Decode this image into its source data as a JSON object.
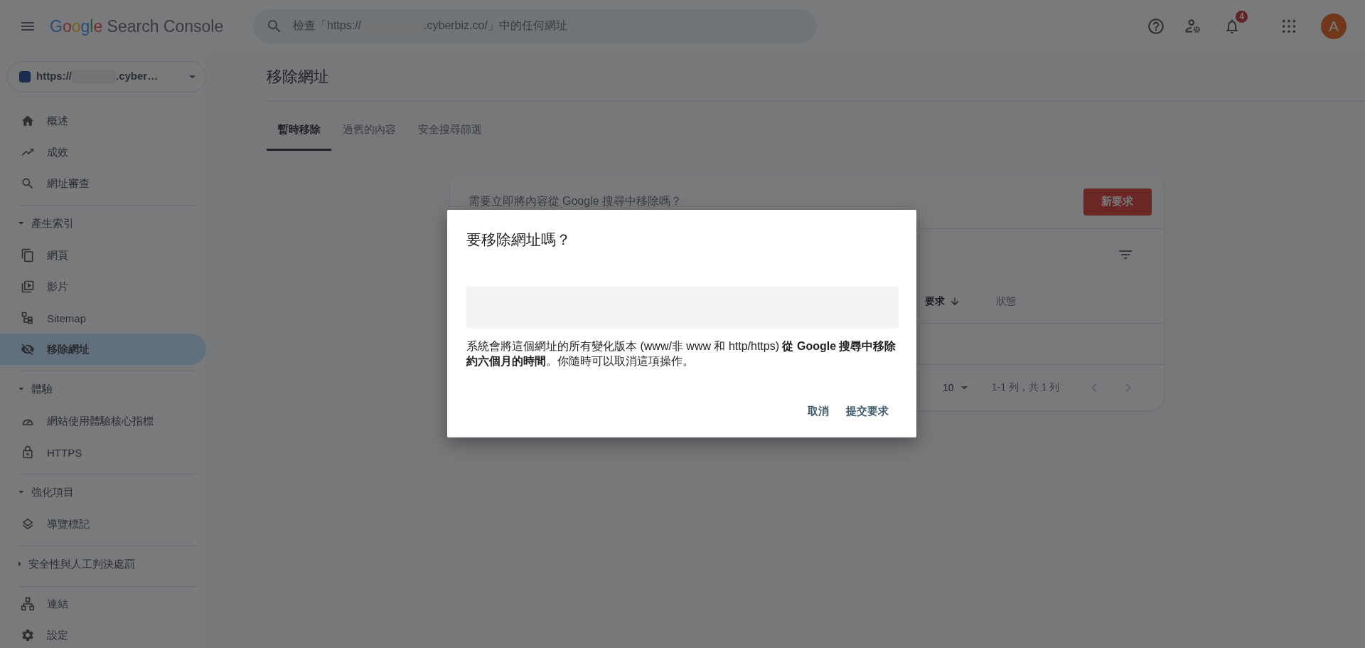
{
  "header": {
    "logo_brand": "Google",
    "logo_product": "Search Console",
    "search": {
      "placeholder_parts": [
        "檢查「https://",
        ".cyberbiz.co/」中的任何網址"
      ]
    },
    "notification_count": "4",
    "avatar_letter": "A"
  },
  "sidebar": {
    "property": {
      "url_parts": [
        "https://",
        ".cyber…"
      ]
    },
    "groups": [
      {
        "items": [
          {
            "label": "概述",
            "selected": false
          },
          {
            "label": "成效",
            "selected": false
          },
          {
            "label": "網址審查",
            "selected": false
          }
        ]
      },
      {
        "title": "產生索引",
        "expanded": true,
        "items": [
          {
            "label": "網頁",
            "selected": false
          },
          {
            "label": "影片",
            "selected": false
          },
          {
            "label": "Sitemap",
            "selected": false
          },
          {
            "label": "移除網址",
            "selected": true
          }
        ]
      },
      {
        "title": "體驗",
        "expanded": true,
        "items": [
          {
            "label": "網站使用體驗核心指標",
            "selected": false
          },
          {
            "label": "HTTPS",
            "selected": false
          }
        ]
      },
      {
        "title": "強化項目",
        "expanded": true,
        "items": [
          {
            "label": "導覽標記",
            "selected": false
          }
        ]
      },
      {
        "title": "安全性與人工判決處罰",
        "expanded": false
      },
      {
        "items": [
          {
            "label": "連結",
            "selected": false
          },
          {
            "label": "設定",
            "selected": false
          }
        ]
      }
    ]
  },
  "page": {
    "title": "移除網址",
    "tabs": [
      {
        "label": "暫時移除",
        "selected": true
      },
      {
        "label": "過舊的內容",
        "selected": false
      },
      {
        "label": "安全搜尋篩選",
        "selected": false
      }
    ],
    "card": {
      "prompt": "需要立即將內容從 Google 搜尋中移除嗎？",
      "new_request_button": "新要求",
      "columns": [
        {
          "label": "要求",
          "sorted": true
        },
        {
          "label": "狀態",
          "sorted": false
        }
      ],
      "rows_per_page": "10",
      "range": "1-1 列，共 1 列"
    }
  },
  "dialog": {
    "title": "要移除網址嗎？",
    "description": "系統會將這個網址的所有變化版本 (www/非 www 和 http/https) **從 Google 搜尋中移除約六個月的時間**。你隨時可以取消這項操作。",
    "buttons": [
      "取消",
      "提交要求"
    ]
  }
}
